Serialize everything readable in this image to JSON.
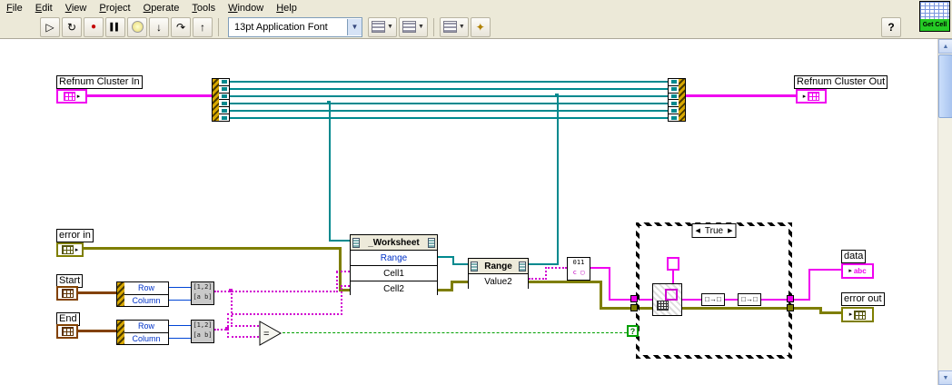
{
  "menu": {
    "items": [
      "File",
      "Edit",
      "View",
      "Project",
      "Operate",
      "Tools",
      "Window",
      "Help"
    ]
  },
  "toolbar": {
    "run": "▷",
    "run_continuous": "↻",
    "abort": "●",
    "pause": "▌▌",
    "step_into": "↓",
    "step_over": "↷",
    "step_out": "↑",
    "font_selector": "13pt Application Font",
    "dropdown_arrow": "▼",
    "cleanup": "✦",
    "help": "?"
  },
  "vi_icon": {
    "label": "Get Cell"
  },
  "labels": {
    "refnum_in": "Refnum Cluster In",
    "refnum_out": "Refnum Cluster Out",
    "error_in": "error in",
    "start": "Start",
    "end": "End",
    "data": "data",
    "error_out": "error out"
  },
  "nodes": {
    "worksheet": {
      "header": "_Worksheet",
      "row_range": "Range",
      "row_cell1": "Cell1",
      "row_cell2": "Cell2"
    },
    "range": {
      "header": "Range",
      "row_value2": "Value2"
    },
    "unbundle": {
      "row1": "Row",
      "row2": "Column"
    },
    "build": {
      "line1": "[1,2]",
      "line2": "[a b]"
    },
    "equals": "=",
    "variant": {
      "line1": "011",
      "line2": "c ▢"
    },
    "conv": "□→□"
  },
  "case": {
    "selector": "True",
    "left_arrow": "◀",
    "right_arrow": "▶",
    "terminal": "?"
  },
  "terminals": {
    "data_glyph": "abc"
  },
  "scrollbar": {
    "up": "▲",
    "down": "▼"
  },
  "colors": {
    "refnum_pink": "#F000F0",
    "automation_teal": "#00898E",
    "error_olive": "#7E7E00",
    "int_blue": "#0045D6",
    "bool_green": "#00A000",
    "cluster_brown": "#824100",
    "icon_green": "#25CB25"
  }
}
